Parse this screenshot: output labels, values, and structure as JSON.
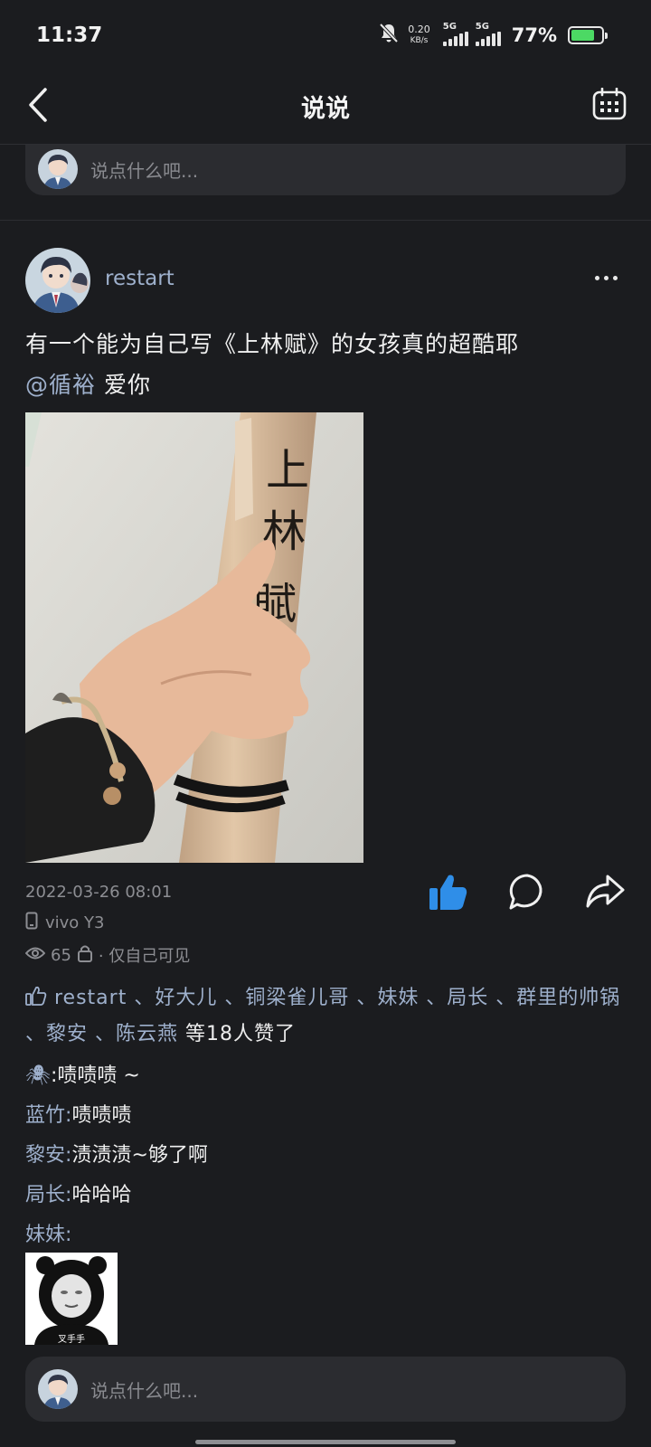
{
  "status_bar": {
    "time": "11:37",
    "net_speed_value": "0.20",
    "net_speed_unit": "KB/s",
    "sim1_label": "5G",
    "sim2_label": "5G",
    "battery_percent": "77%",
    "battery_level": 0.77
  },
  "nav": {
    "title": "说说",
    "back_icon": "chevron-left-icon",
    "calendar_icon": "calendar-icon"
  },
  "top_input": {
    "placeholder": "说点什么吧..."
  },
  "post": {
    "username": "restart",
    "text": "有一个能为自己写《上林赋》的女孩真的超酷耶",
    "mention": "@循裕",
    "text_suffix": " 爱你",
    "photo_caption_chars": [
      "上",
      "林",
      "賦"
    ],
    "time": "2022-03-26 08:01",
    "device": "vivo Y3",
    "views": "65",
    "visibility": "· 仅自己可见",
    "liked": true,
    "accent_color": "#2f8ee8"
  },
  "likes": {
    "names": "restart 、好大儿 、铜梁雀儿哥 、妹妹 、局长 、群里的帅锅 、黎安 、陈云燕",
    "suffix": " 等18人赞了"
  },
  "comments": [
    {
      "name": "🕷",
      "sep": ": ",
      "text": "啧啧啧 ~"
    },
    {
      "name": "蓝竹",
      "sep": ": ",
      "text": "啧啧啧"
    },
    {
      "name": "黎安",
      "sep": ": ",
      "text": "渍渍渍~够了啊"
    },
    {
      "name": "局长",
      "sep": ": ",
      "text": "哈哈哈"
    },
    {
      "name": "妹妹",
      "sep": ":",
      "text": ""
    }
  ],
  "meme_caption": "叉手手",
  "bottom_input": {
    "placeholder": "说点什么吧..."
  }
}
